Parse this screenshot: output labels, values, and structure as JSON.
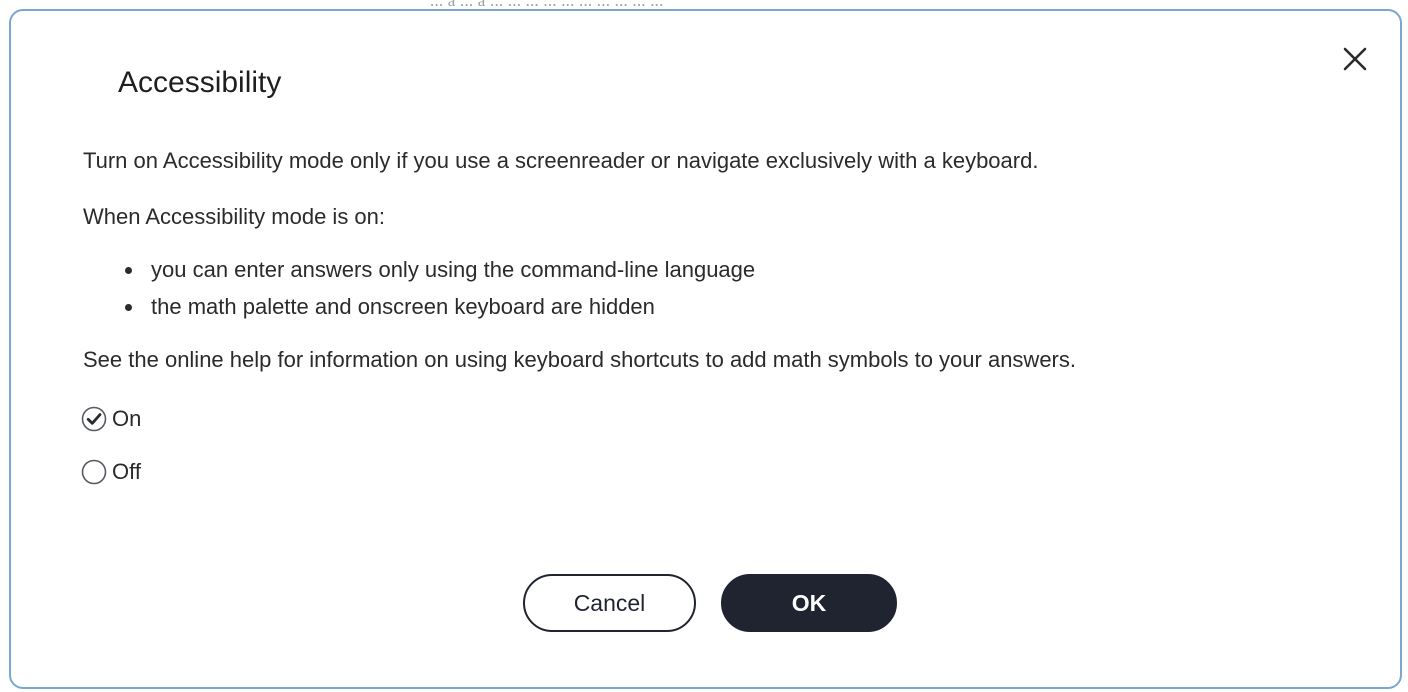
{
  "backdrop": {
    "partial_text": "... a ... a ... ... ... ... ... ... ... ... ... ..."
  },
  "dialog": {
    "title": "Accessibility",
    "close_icon": "close-icon",
    "intro": "Turn on Accessibility mode only if you use a screenreader or navigate exclusively with a keyboard.",
    "when_on": "When Accessibility mode is on:",
    "bullets": [
      "you can enter answers only using the command-line language",
      "the math palette and onscreen keyboard are hidden"
    ],
    "help": "See the online help for information on using keyboard shortcuts to add math symbols to your answers.",
    "options": [
      {
        "label": "On",
        "selected": true,
        "icon": "check-circle-icon"
      },
      {
        "label": "Off",
        "selected": false,
        "icon": "empty-circle-icon"
      }
    ],
    "buttons": {
      "cancel": "Cancel",
      "ok": "OK"
    }
  },
  "colors": {
    "dialog_border": "#7aa7cf",
    "primary_button": "#1f2430",
    "text": "#2b2b2b"
  }
}
